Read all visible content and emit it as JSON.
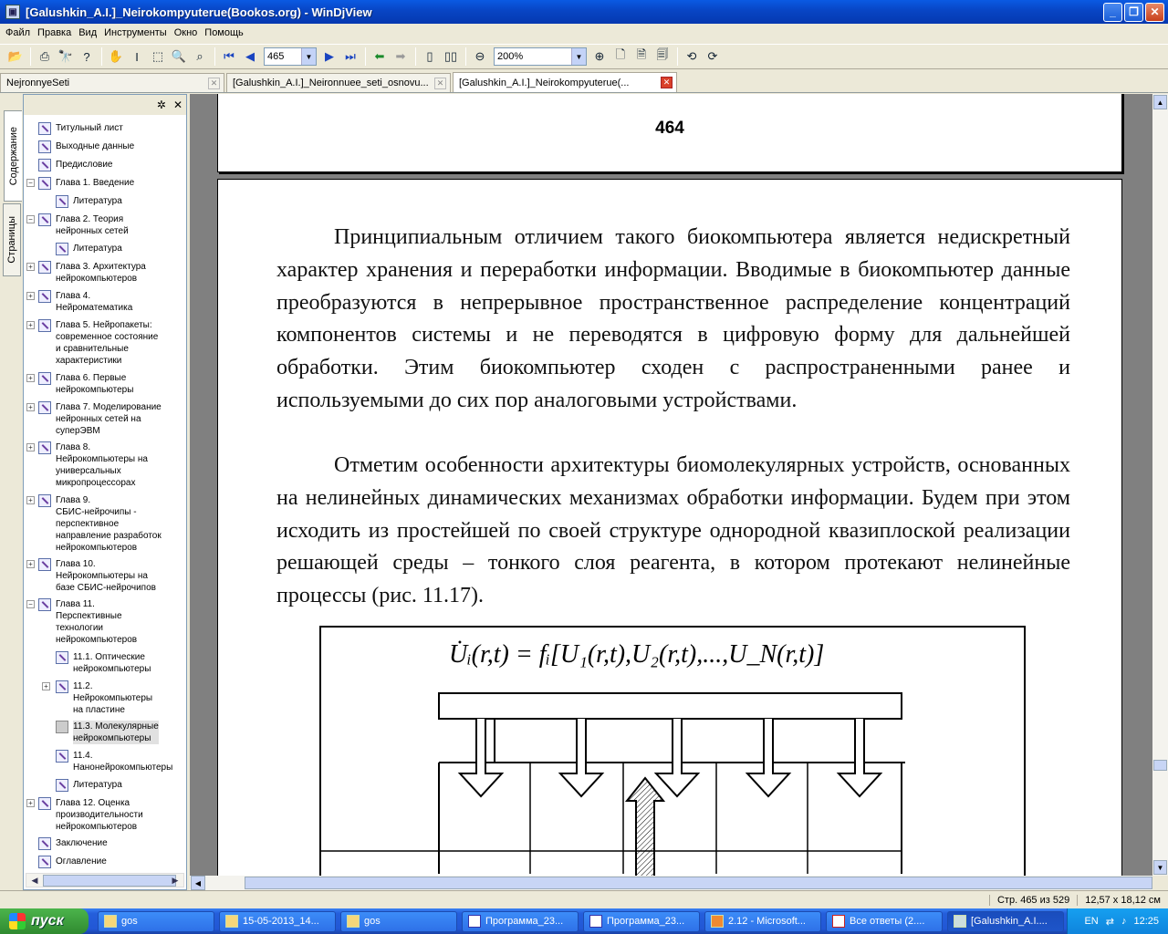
{
  "window": {
    "title": "[Galushkin_A.I.]_Neirokompyuterue(Bookos.org) - WinDjView"
  },
  "menu": [
    "Файл",
    "Правка",
    "Вид",
    "Инструменты",
    "Окно",
    "Помощь"
  ],
  "toolbar": {
    "page_value": "465",
    "zoom_value": "200%"
  },
  "tabs": [
    {
      "label": "NejronnyeSeti"
    },
    {
      "label": "[Galushkin_A.I.]_Neironnuee_seti_osnovu..."
    },
    {
      "label": "[Galushkin_A.I.]_Neirokompyuterue(..."
    }
  ],
  "side_tabs": {
    "contents": "Содержание",
    "pages": "Страницы"
  },
  "toc": [
    {
      "label": "Титульный лист"
    },
    {
      "label": "Выходные данные"
    },
    {
      "label": "Предисловие"
    },
    {
      "label": "Глава 1. Введение"
    },
    {
      "label": "Литература"
    },
    {
      "label": "Глава 2. Теория\nнейронных сетей"
    },
    {
      "label": "Литература"
    },
    {
      "label": "Глава 3. Архитектура\nнейрокомпьютеров"
    },
    {
      "label": "Глава 4.\nНейроматематика"
    },
    {
      "label": "Глава 5. Нейропакеты:\nсовременное состояние\nи сравнительные\nхарактеристики"
    },
    {
      "label": "Глава 6. Первые\nнейрокомпьютеры"
    },
    {
      "label": "Глава 7. Моделирование\nнейронных сетей на\nсуперЭВМ"
    },
    {
      "label": "Глава 8.\nНейрокомпьютеры на\nуниверсальных\nмикропроцессорах"
    },
    {
      "label": "Глава 9.\nСБИС-нейрочипы -\nперспективное\nнаправление разработок\nнейрокомпьютеров"
    },
    {
      "label": "Глава 10.\nНейрокомпьютеры на\nбазе СБИС-нейрочипов"
    },
    {
      "label": "Глава 11.\nПерспективные\nтехнологии\nнейрокомпьютеров"
    },
    {
      "label": "11.1. Оптические\nнейрокомпьютеры"
    },
    {
      "label": "11.2.\nНейрокомпьютеры\nна пластине"
    },
    {
      "label": "11.3. Молекулярные\nнейрокомпьютеры"
    },
    {
      "label": "11.4.\nНанонейрокомпьютеры"
    },
    {
      "label": "Литература"
    },
    {
      "label": "Глава 12. Оценка\nпроизводительности\nнейрокомпьютеров"
    },
    {
      "label": "Заключение"
    },
    {
      "label": "Оглавление"
    }
  ],
  "document": {
    "page_number": "464",
    "paragraph1": "Принципиальным отличием такого биокомпьютера является недискретный характер хранения и переработки информации. Вводимые в биокомпьютер данные преобразуются в непрерывное пространственное распределение концентраций компонентов системы и не переводятся в цифровую форму для дальнейшей обработки. Этим биокомпьютер сходен с распространенными ранее и используемыми до сих пор аналоговыми устройствами.",
    "paragraph2": "Отметим особенности архитектуры биомолекулярных устройств, основанных на нелинейных динамических механизмах обработки информации. Будем при этом исходить из простейшей по своей структуре однородной квазиплоской реализации решающей среды – тонкого слоя реагента, в котором протекают нелинейные процессы (рис. 11.17).",
    "formula": "U̇ᵢ(r,t) = fᵢ[U₁(r,t),U₂(r,t),...,U_N(r,t)]"
  },
  "status": {
    "page": "Стр. 465 из 529",
    "size": "12,57 x 18,12 см"
  },
  "taskbar": {
    "start": "пуск",
    "items": [
      {
        "label": "gos"
      },
      {
        "label": "15-05-2013_14..."
      },
      {
        "label": "gos"
      },
      {
        "label": "Программа_23..."
      },
      {
        "label": "Программа_23..."
      },
      {
        "label": "2.12 - Microsoft..."
      },
      {
        "label": "Все ответы (2...."
      },
      {
        "label": "[Galushkin_A.I...."
      }
    ],
    "lang": "EN",
    "clock": "12:25"
  }
}
